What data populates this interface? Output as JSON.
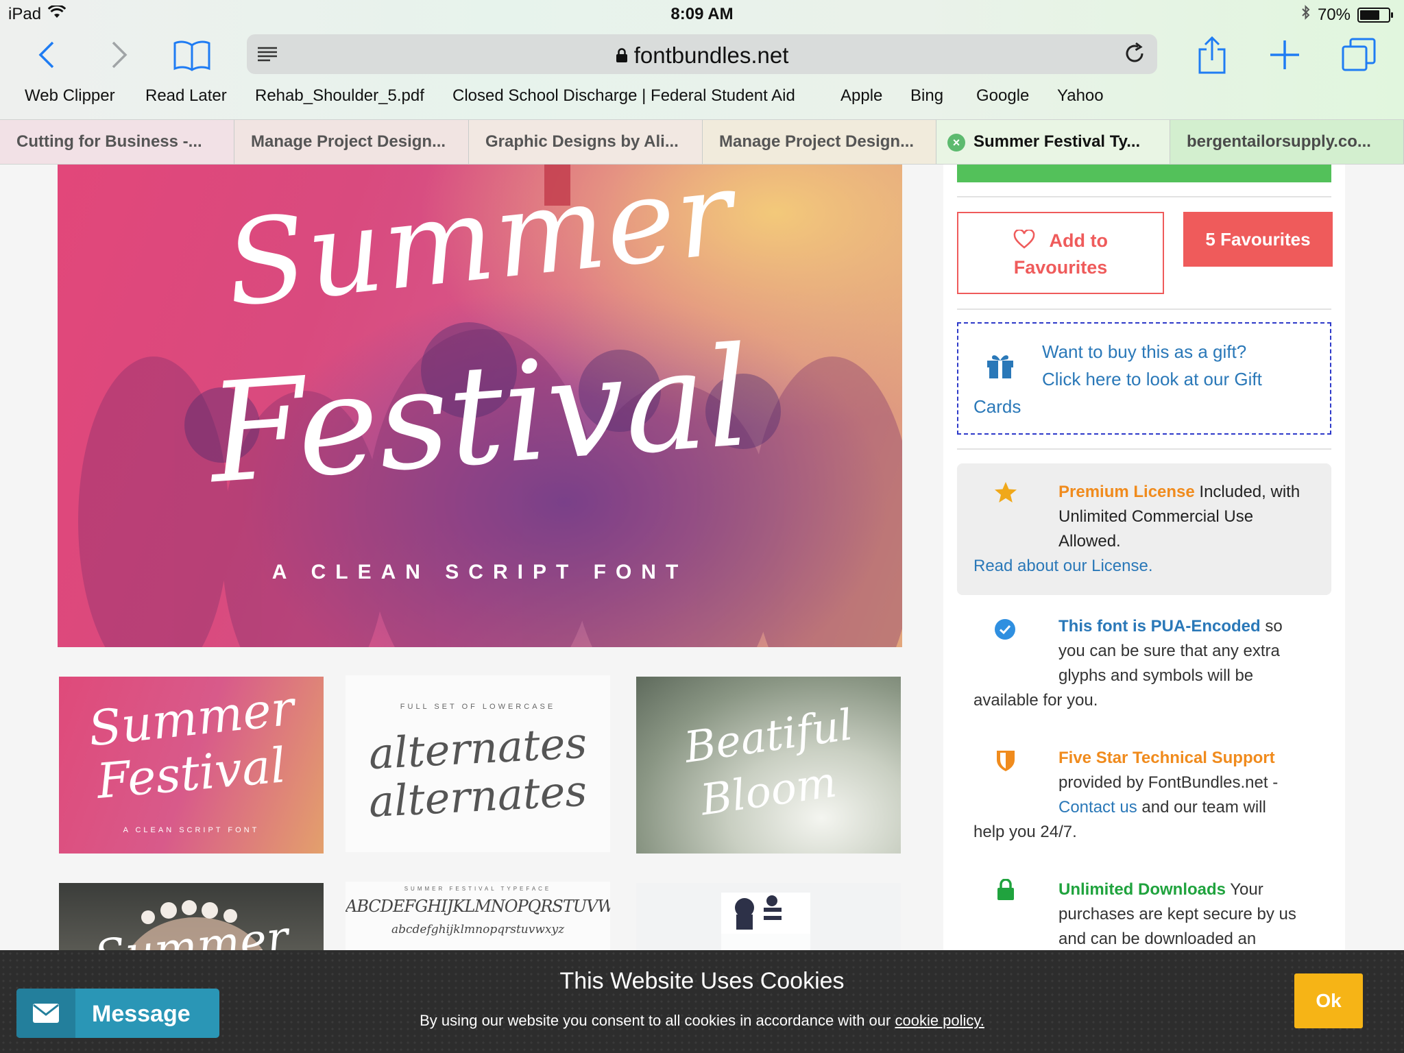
{
  "status_bar": {
    "device": "iPad",
    "time": "8:09 AM",
    "battery": "70%",
    "battery_level": 0.7
  },
  "toolbar": {
    "url": "fontbundles.net"
  },
  "bookmarks": [
    "Web Clipper",
    "Read Later",
    "Rehab_Shoulder_5.pdf",
    "Closed School Discharge | Federal Student Aid",
    "Apple",
    "Bing",
    "Google",
    "Yahoo"
  ],
  "tabs": [
    {
      "label": "Cutting for Business -..."
    },
    {
      "label": "Manage Project Design..."
    },
    {
      "label": "Graphic Designs by Ali..."
    },
    {
      "label": "Manage Project Design..."
    },
    {
      "label": "Summer Festival Ty...",
      "active": true
    },
    {
      "label": "bergentailorsupply.co..."
    }
  ],
  "hero": {
    "line1": "Summer",
    "line2": "Festival",
    "subtitle": "A CLEAN SCRIPT FONT"
  },
  "thumbs": {
    "t1": {
      "line1": "Summer",
      "line2": "Festival",
      "sub": "A CLEAN SCRIPT FONT"
    },
    "t2": {
      "heading": "FULL SET OF LOWERCASE",
      "line1": "alternates",
      "line2": "alternates"
    },
    "t3": {
      "line1": "Beatiful",
      "line2": "Bloom"
    },
    "t4": {
      "line1": "Summer"
    },
    "t5": {
      "heading": "SUMMER FESTIVAL TYPEFACE",
      "upper": "ABCDEFGHIJKLMNOPQRSTUVWXYZ",
      "lower": "abcdefghijklmnopqrstuvwxyz"
    }
  },
  "sidebar": {
    "fav_line1": "Add to",
    "fav_line2": "Favourites",
    "fav_count": "5 Favourites",
    "gift_l1": "Want to buy this as a gift?",
    "gift_l2": "Click here to look at our Gift",
    "gift_l3": "Cards",
    "license_title": "Premium License",
    "license_rest": " Included, with",
    "license_l2": "Unlimited Commercial Use",
    "license_l3": "Allowed.",
    "license_link": "Read about our License.",
    "pua_title": "This font is PUA-Encoded",
    "pua_rest": " so",
    "pua_l2": "you can be sure that any extra",
    "pua_l3": "glyphs and symbols will be",
    "pua_l4": "available for you.",
    "support_title": "Five Star Technical Support",
    "support_l2": "provided by FontBundles.net -",
    "support_link": "Contact us",
    "support_rest": " and our team will",
    "support_l4": "help you 24/7.",
    "downloads_title": "Unlimited Downloads",
    "downloads_rest": " Your",
    "downloads_l2": "purchases are kept secure by us",
    "downloads_l3": "and can be downloaded an"
  },
  "cookie": {
    "title": "This Website Uses Cookies",
    "text": "By using our website you consent to all cookies in accordance with our ",
    "link": "cookie policy.",
    "ok": "Ok",
    "message": "Message"
  }
}
